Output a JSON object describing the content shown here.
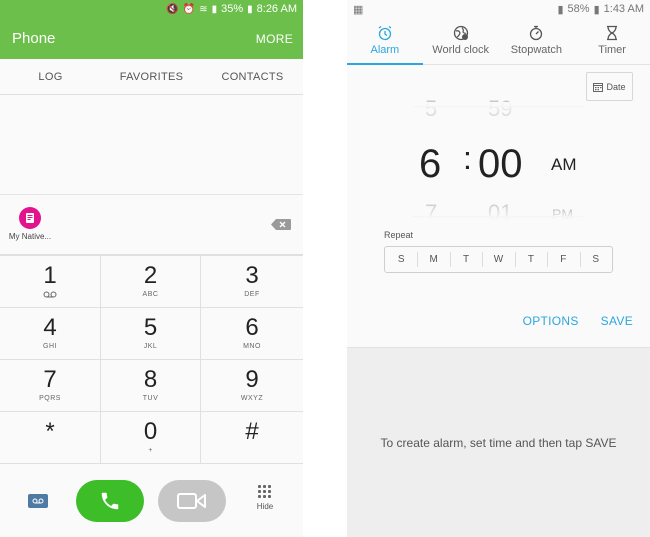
{
  "phone": {
    "status": {
      "time": "8:26 AM",
      "battery": "35%"
    },
    "title": "Phone",
    "more": "MORE",
    "tabs": [
      "LOG",
      "FAVORITES",
      "CONTACTS"
    ],
    "shortcut": {
      "label": "My Native...",
      "icon": "contact-app-icon",
      "color": "#e2138c"
    },
    "keys": [
      {
        "digit": "1",
        "sub": ""
      },
      {
        "digit": "2",
        "sub": "ABC"
      },
      {
        "digit": "3",
        "sub": "DEF"
      },
      {
        "digit": "4",
        "sub": "GHI"
      },
      {
        "digit": "5",
        "sub": "JKL"
      },
      {
        "digit": "6",
        "sub": "MNO"
      },
      {
        "digit": "7",
        "sub": "PQRS"
      },
      {
        "digit": "8",
        "sub": "TUV"
      },
      {
        "digit": "9",
        "sub": "WXYZ"
      },
      {
        "digit": "*",
        "sub": ""
      },
      {
        "digit": "0",
        "sub": "+"
      },
      {
        "digit": "#",
        "sub": ""
      }
    ],
    "hide": "Hide",
    "colors": {
      "brand": "#6dbf4b",
      "call": "#3dbd28",
      "video": "#c6c6c6"
    }
  },
  "clock": {
    "status": {
      "time": "1:43 AM",
      "battery": "58%"
    },
    "tabs": [
      {
        "label": "Alarm",
        "icon": "alarm-clock-icon",
        "active": true
      },
      {
        "label": "World clock",
        "icon": "globe-icon",
        "active": false
      },
      {
        "label": "Stopwatch",
        "icon": "stopwatch-icon",
        "active": false
      },
      {
        "label": "Timer",
        "icon": "hourglass-icon",
        "active": false
      }
    ],
    "date_button": "Date",
    "picker": {
      "prev_hour": "5",
      "prev_minute": "59",
      "hour": "6",
      "separator": ":",
      "minute": "00",
      "ampm": "AM",
      "next_hour": "7",
      "next_minute": "01",
      "next_ampm": "PM"
    },
    "repeat_label": "Repeat",
    "days": [
      "S",
      "M",
      "T",
      "W",
      "T",
      "F",
      "S"
    ],
    "options": "OPTIONS",
    "save": "SAVE",
    "hint": "To create alarm, set time and then tap SAVE",
    "colors": {
      "accent": "#2aa7df"
    }
  }
}
